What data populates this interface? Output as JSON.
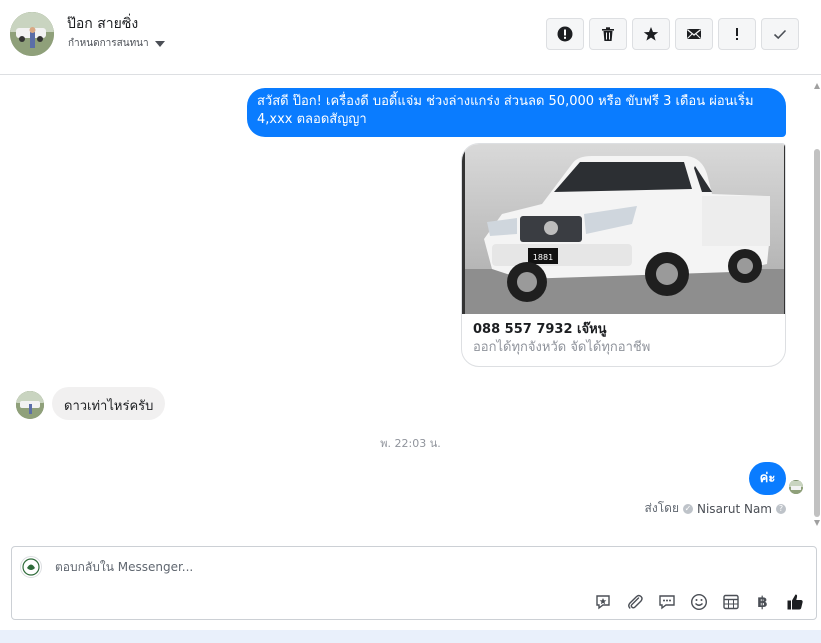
{
  "header": {
    "contact_name": "ป๊อก สายซิ่ง",
    "assign_label": "กำหนดการสนทนา",
    "actions": [
      {
        "name": "spam",
        "icon": "alert-circle-icon"
      },
      {
        "name": "delete",
        "icon": "trash-icon"
      },
      {
        "name": "star",
        "icon": "star-icon"
      },
      {
        "name": "mark-unread",
        "icon": "envelope-icon"
      },
      {
        "name": "follow-up",
        "icon": "exclamation-icon"
      },
      {
        "name": "done",
        "icon": "check-icon"
      }
    ]
  },
  "thread": {
    "messages": [
      {
        "direction": "outgoing",
        "text": "สวัสดี ป๊อก! เครื่องดี บอดี้แจ่ม ช่วงล่างแกร่ง ส่วนลด 50,000 หรือ ขับฟรี 3 เดือน ผ่อนเริ่ม 4,xxx ตลอดสัญญา"
      },
      {
        "direction": "outgoing",
        "type": "card",
        "title": "088 557 7932 เจ๊หนู",
        "subtitle": "ออกได้ทุกจังหวัด จัดได้ทุกอาชีพ",
        "plate_text": "1881"
      },
      {
        "direction": "incoming",
        "text": "ดาวเท่าไหร่ครับ"
      },
      {
        "direction": "outgoing",
        "text": "ค่ะ"
      }
    ],
    "timestamp": "พ. 22:03 น.",
    "sent_by_prefix": "ส่งโดย",
    "sent_by_name": "Nisarut Nam"
  },
  "composer": {
    "placeholder": "ตอบกลับใน Messenger...",
    "tools": [
      "sticker-icon",
      "attachment-icon",
      "saved-reply-icon",
      "emoji-icon",
      "appointment-icon",
      "baht-icon",
      "like-icon"
    ],
    "baht_symbol": "฿"
  },
  "colors": {
    "outgoing_bubble": "#0a7cff",
    "incoming_bubble": "#f1f0f0",
    "footer_band": "#e9f0fb"
  }
}
